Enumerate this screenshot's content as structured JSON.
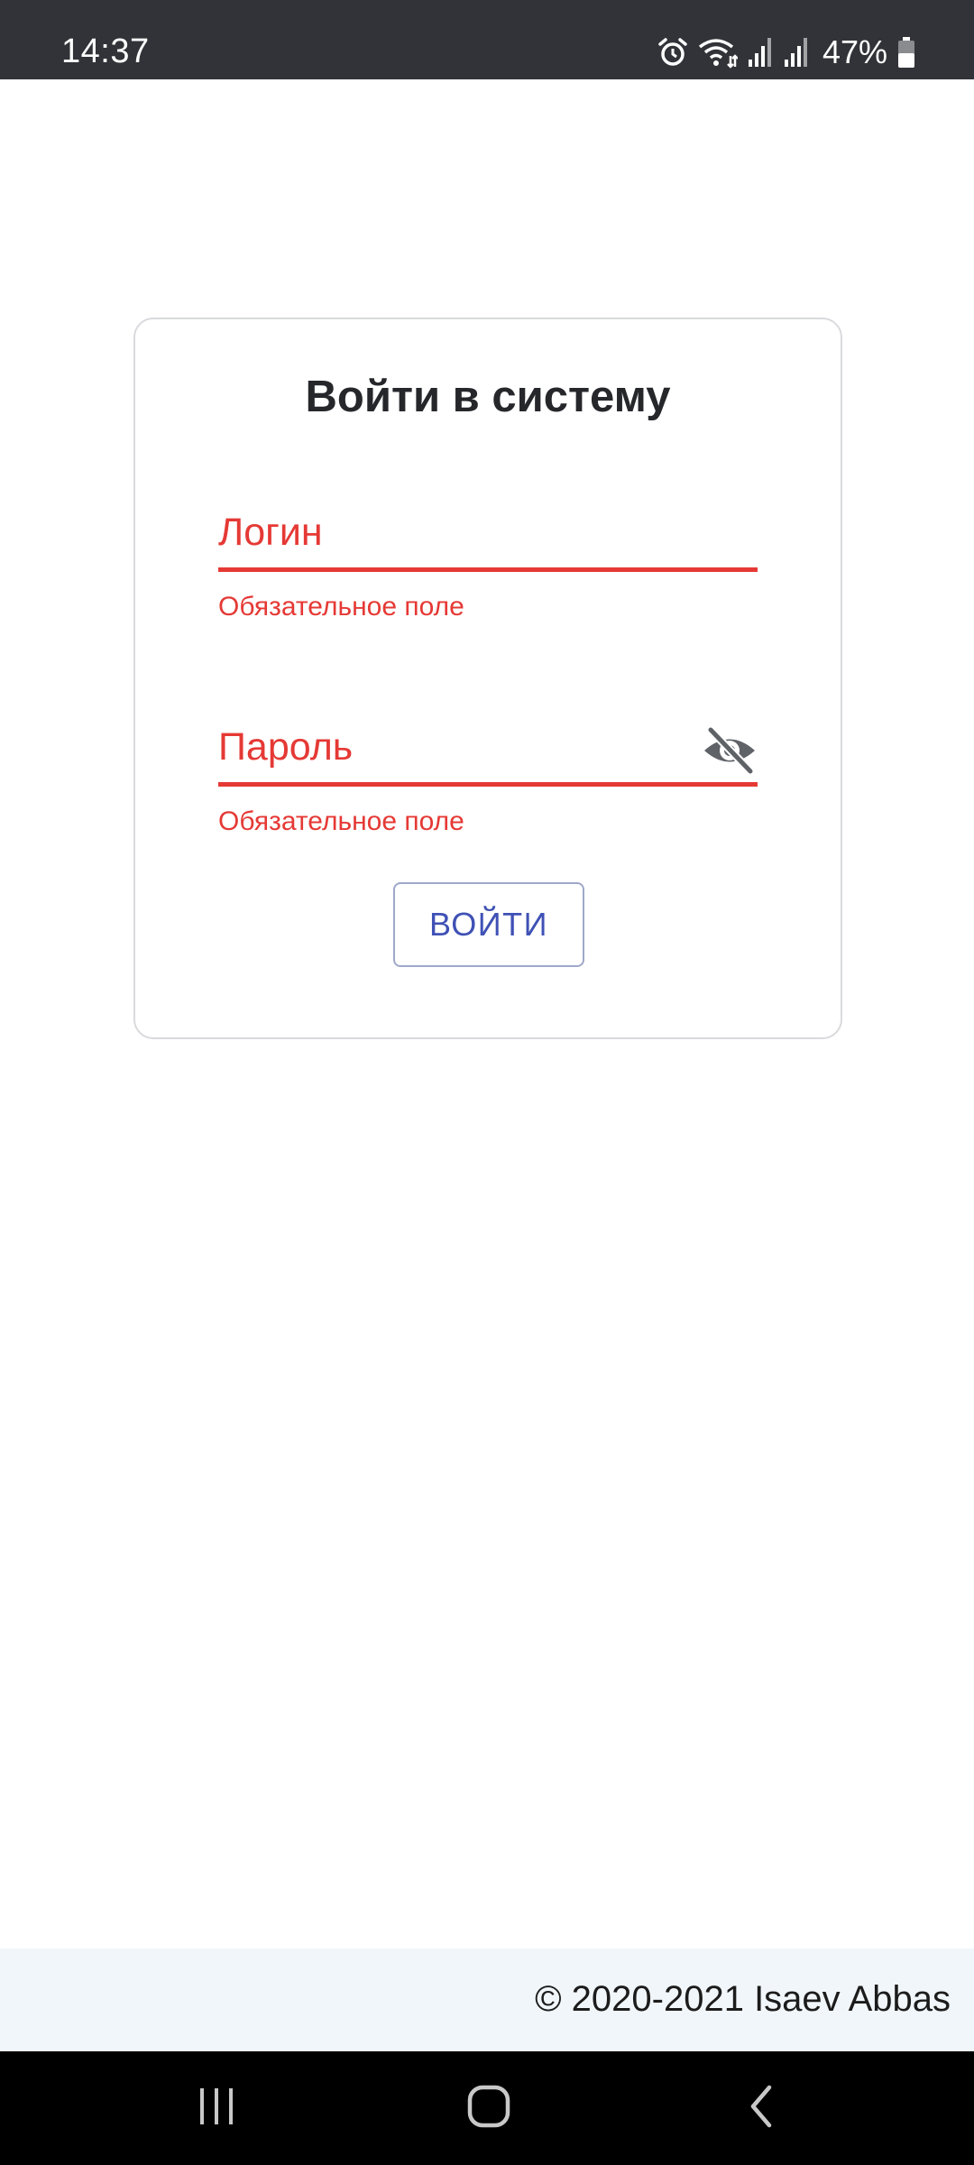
{
  "status_bar": {
    "time": "14:37",
    "battery_percent": "47%",
    "icons": [
      "alarm-icon",
      "wifi-icon",
      "signal-icon",
      "signal-icon",
      "battery-icon"
    ],
    "battery_level": 0.47
  },
  "login_form": {
    "title": "Войти в систему",
    "login_field": {
      "placeholder": "Логин",
      "value": "",
      "error": "Обязательное поле"
    },
    "password_field": {
      "placeholder": "Пароль",
      "value": "",
      "error": "Обязательное поле",
      "visibility_icon": "eye-off-icon"
    },
    "submit_label": "ВОЙТИ"
  },
  "footer": {
    "copyright": "© 2020-2021 Isaev Abbas"
  },
  "nav_bar": {
    "buttons": [
      "recents-icon",
      "home-icon",
      "back-icon"
    ]
  },
  "colors": {
    "error": "#e53935",
    "primary": "#3f51b5",
    "status_bar_bg": "#323338",
    "footer_bg": "#f1f6fa"
  }
}
